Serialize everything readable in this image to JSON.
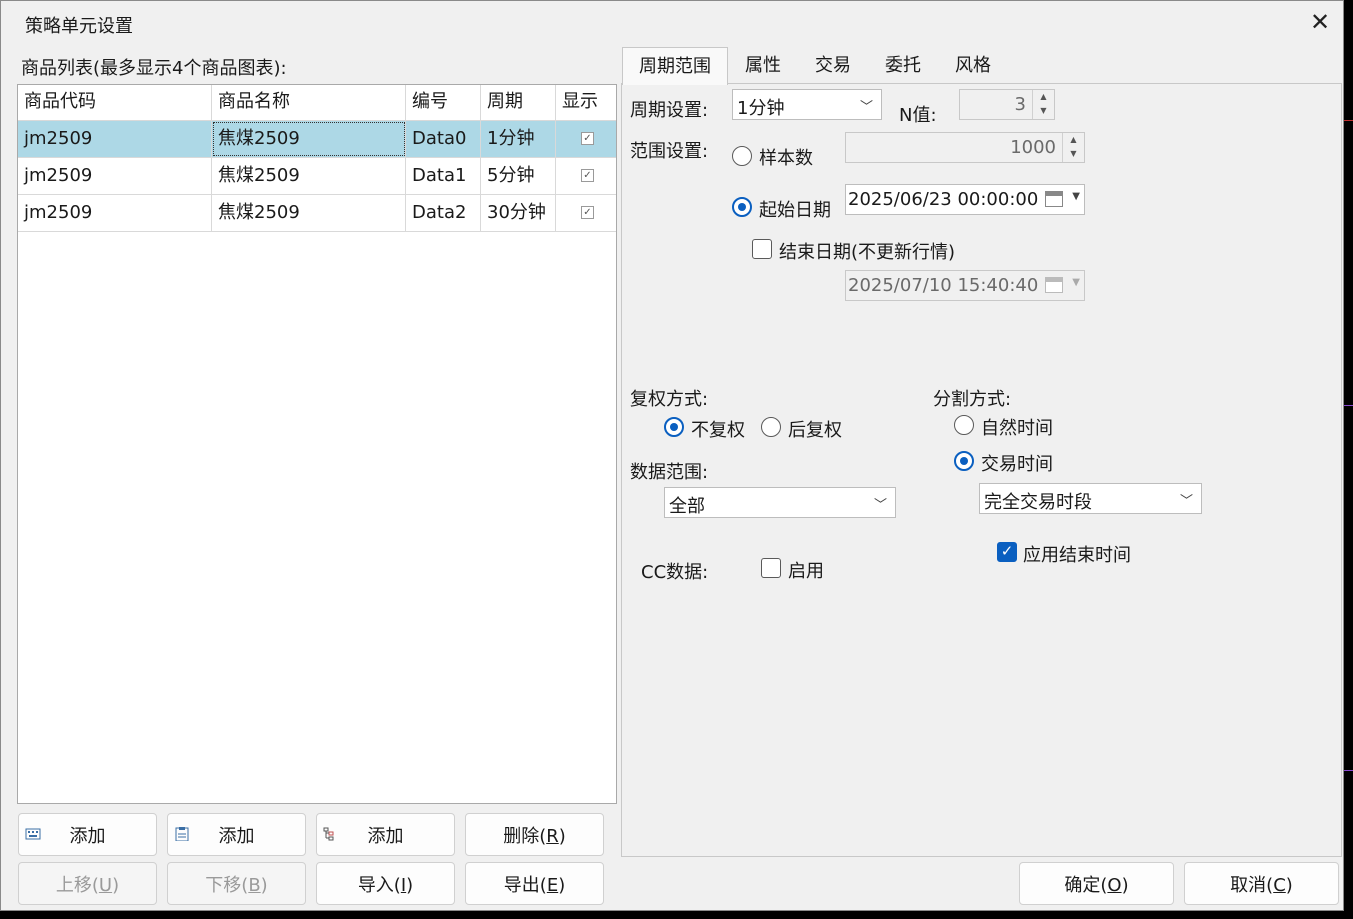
{
  "window": {
    "title": "策略单元设置"
  },
  "list": {
    "label": "商品列表(最多显示4个商品图表):",
    "columns": [
      "商品代码",
      "商品名称",
      "编号",
      "周期",
      "显示"
    ],
    "rows": [
      {
        "code": "jm2509",
        "name": "焦煤2509",
        "id": "Data0",
        "period": "1分钟",
        "show": true,
        "selected": true
      },
      {
        "code": "jm2509",
        "name": "焦煤2509",
        "id": "Data1",
        "period": "5分钟",
        "show": true,
        "selected": false
      },
      {
        "code": "jm2509",
        "name": "焦煤2509",
        "id": "Data2",
        "period": "30分钟",
        "show": true,
        "selected": false
      }
    ]
  },
  "buttons": {
    "add1": "添加",
    "add2": "添加",
    "add3": "添加",
    "delete": {
      "text": "删除(",
      "key": "R",
      "end": ")"
    },
    "up": {
      "text": "上移(",
      "key": "U",
      "end": ")"
    },
    "down": {
      "text": "下移(",
      "key": "B",
      "end": ")"
    },
    "import": {
      "text": "导入(",
      "key": "I",
      "end": ")"
    },
    "export": {
      "text": "导出(",
      "key": "E",
      "end": ")"
    },
    "ok": {
      "text": "确定(",
      "key": "O",
      "end": ")"
    },
    "cancel": {
      "text": "取消(",
      "key": "C",
      "end": ")"
    }
  },
  "tabs": [
    "周期范围",
    "属性",
    "交易",
    "委托",
    "风格"
  ],
  "period": {
    "label": "周期设置:",
    "value": "1分钟",
    "n_label": "N值:",
    "n_value": "3"
  },
  "range": {
    "label": "范围设置:",
    "sample_label": "样本数",
    "sample_value": "1000",
    "start_label": "起始日期",
    "start_value": "2025/06/23 00:00:00",
    "end_label": "结束日期(不更新行情)",
    "end_value": "2025/07/10 15:40:40",
    "mode": "start"
  },
  "adjust": {
    "label": "复权方式:",
    "opt1": "不复权",
    "opt2": "后复权",
    "selected": "不复权"
  },
  "datarange": {
    "label": "数据范围:",
    "value": "全部"
  },
  "split": {
    "label": "分割方式:",
    "opt1": "自然时间",
    "opt2": "交易时间",
    "selected": "交易时间",
    "session_value": "完全交易时段",
    "apply_end_label": "应用结束时间",
    "apply_end": true
  },
  "cc": {
    "label": "CC数据:",
    "enable_label": "启用",
    "enabled": false
  },
  "colors": {
    "selected_row": "#add8e6",
    "accent": "#0a5fc0"
  }
}
